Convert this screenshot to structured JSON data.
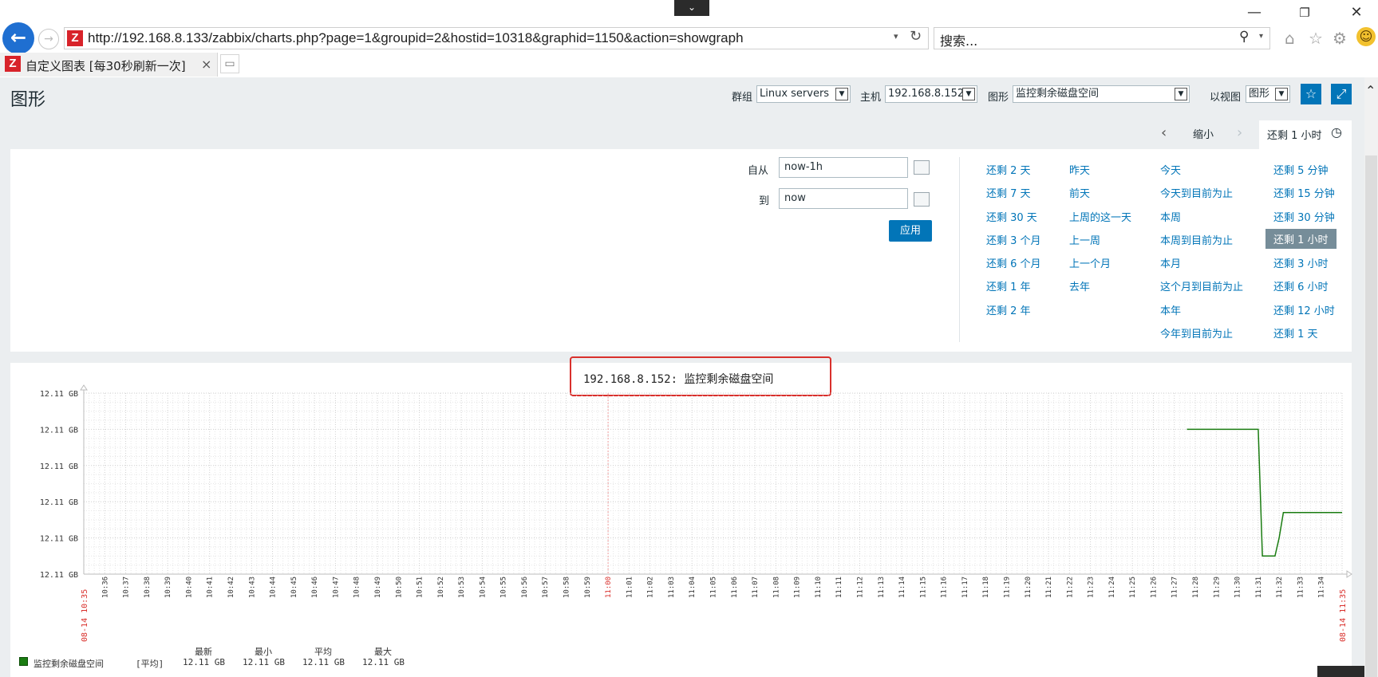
{
  "browser": {
    "address": "http://192.168.8.133/zabbix/charts.php?page=1&groupid=2&hostid=10318&graphid=1150&action=showgraph",
    "search_placeholder": "搜索...",
    "tab_title": "自定义图表 [每30秒刷新一次]"
  },
  "header": {
    "title": "图形",
    "group_label": "群组",
    "group_value": "Linux servers",
    "host_label": "主机",
    "host_value": "192.168.8.152",
    "graph_label": "图形",
    "graph_value": "监控剩余磁盘空间",
    "view_label": "以视图",
    "view_value": "图形"
  },
  "timebar": {
    "zoom_out": "缩小",
    "current_period": "还剩 1 小时"
  },
  "filter": {
    "from_label": "自从",
    "from_value": "now-1h",
    "to_label": "到",
    "to_value": "now",
    "apply": "应用",
    "quick_ranges": [
      [
        "还剩 2 天",
        "还剩 7 天",
        "还剩 30 天",
        "还剩 3 个月",
        "还剩 6 个月",
        "还剩 1 年",
        "还剩 2 年"
      ],
      [
        "昨天",
        "前天",
        "上周的这一天",
        "上一周",
        "上一个月",
        "去年"
      ],
      [
        "今天",
        "今天到目前为止",
        "本周",
        "本周到目前为止",
        "本月",
        "这个月到目前为止",
        "本年",
        "今年到目前为止"
      ],
      [
        "还剩 5 分钟",
        "还剩 15 分钟",
        "还剩 30 分钟",
        "还剩 1 小时",
        "还剩 3 小时",
        "还剩 6 小时",
        "还剩 12 小时",
        "还剩 1 天"
      ]
    ],
    "selected_range": "还剩 1 小时"
  },
  "colors": {
    "series": "#1a7c11",
    "accent": "#0275b8",
    "highlight": "#d9302c"
  },
  "chart_data": {
    "type": "line",
    "title": "192.168.8.152: 监控剩余磁盘空间",
    "y_tick_labels": [
      "12.11 GB",
      "12.11 GB",
      "12.11 GB",
      "12.11 GB",
      "12.11 GB",
      "12.11 GB"
    ],
    "x_tick_labels": [
      "10:36",
      "10:37",
      "10:38",
      "10:39",
      "10:40",
      "10:41",
      "10:42",
      "10:43",
      "10:44",
      "10:45",
      "10:46",
      "10:47",
      "10:48",
      "10:49",
      "10:50",
      "10:51",
      "10:52",
      "10:53",
      "10:54",
      "10:55",
      "10:56",
      "10:57",
      "10:58",
      "10:59",
      "11:00",
      "11:01",
      "11:02",
      "11:03",
      "11:04",
      "11:05",
      "11:06",
      "11:07",
      "11:08",
      "11:09",
      "11:10",
      "11:11",
      "11:12",
      "11:13",
      "11:14",
      "11:15",
      "11:16",
      "11:17",
      "11:18",
      "11:19",
      "11:20",
      "11:21",
      "11:22",
      "11:23",
      "11:24",
      "11:25",
      "11:26",
      "11:27",
      "11:28",
      "11:29",
      "11:30",
      "11:31",
      "11:32",
      "11:33",
      "11:34"
    ],
    "x_start_label": "08-14 10:35",
    "x_end_label": "08-14 11:35",
    "x_range_minutes": [
      0,
      60
    ],
    "y_range_level": [
      0,
      5
    ],
    "series": [
      {
        "name": "监控剩余磁盘空间",
        "points": [
          [
            52.6,
            4
          ],
          [
            56.0,
            4
          ],
          [
            56.2,
            0.5
          ],
          [
            56.6,
            0.5
          ],
          [
            56.8,
            0.5
          ],
          [
            57.0,
            1
          ],
          [
            57.2,
            1.7
          ],
          [
            57.4,
            1.7
          ],
          [
            60,
            1.7
          ]
        ]
      }
    ],
    "legend": {
      "series_name": "监控剩余磁盘空间",
      "function": "[平均]",
      "headers": [
        "最新",
        "最小",
        "平均",
        "最大"
      ],
      "values": [
        "12.11 GB",
        "12.11 GB",
        "12.11 GB",
        "12.11 GB"
      ]
    },
    "grid": true
  }
}
